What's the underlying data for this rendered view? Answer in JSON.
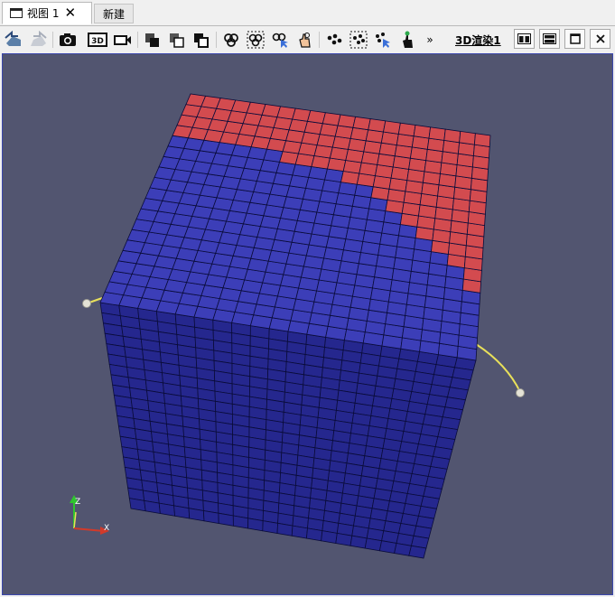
{
  "tabs": [
    {
      "label": "视图 1",
      "close": "✕"
    },
    {
      "label": "新建"
    }
  ],
  "toolbar": {
    "chevron": "»",
    "view_title": "3D渲染1",
    "button_3d_label": "3D"
  },
  "axes": {
    "z": "Z",
    "x": "X"
  },
  "colors": {
    "top_red": "#d34b4f",
    "top_blue": "#3c3eb8",
    "side_blue": "#25278e",
    "background": "#525570",
    "frame": "#3c48ad"
  }
}
